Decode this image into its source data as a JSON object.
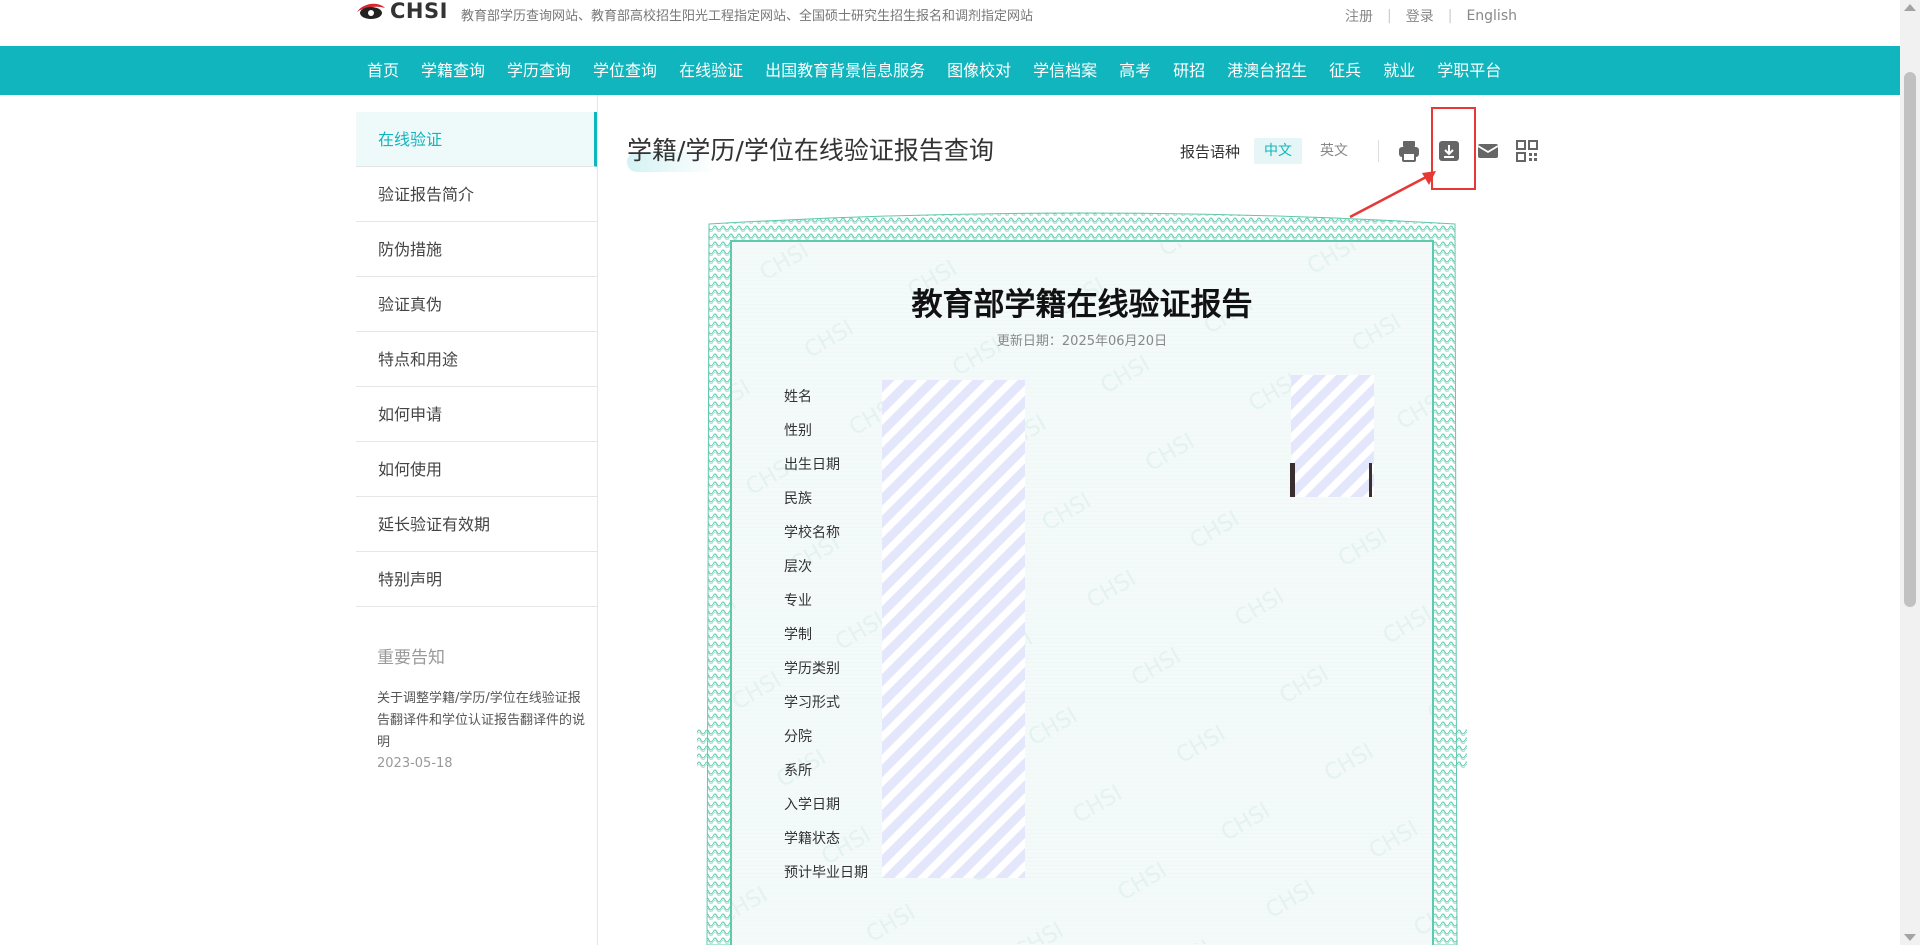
{
  "header": {
    "logo_text": "CHSI",
    "tagline": "教育部学历查询网站、教育部高校招生阳光工程指定网站、全国硕士研究生招生报名和调剂指定网站",
    "links": [
      "注册",
      "登录",
      "English"
    ]
  },
  "nav": {
    "items": [
      "首页",
      "学籍查询",
      "学历查询",
      "学位查询",
      "在线验证",
      "出国教育背景信息服务",
      "图像校对",
      "学信档案",
      "高考",
      "研招",
      "港澳台招生",
      "征兵",
      "就业",
      "学职平台"
    ]
  },
  "sidebar": {
    "items": [
      {
        "label": "在线验证",
        "active": true
      },
      {
        "label": "验证报告简介"
      },
      {
        "label": "防伪措施"
      },
      {
        "label": "验证真伪"
      },
      {
        "label": "特点和用途"
      },
      {
        "label": "如何申请"
      },
      {
        "label": "如何使用"
      },
      {
        "label": "延长验证有效期"
      },
      {
        "label": "特别声明"
      }
    ],
    "notice": {
      "title": "重要告知",
      "link": "关于调整学籍/学历/学位在线验证报告翻译件和学位认证报告翻译件的说明",
      "date": "2023-05-18"
    }
  },
  "main": {
    "title": "学籍/学历/学位在线验证报告查询",
    "language_label": "报告语种",
    "language_options": [
      "中文",
      "英文"
    ],
    "selected_language": "中文",
    "tools": [
      "print-icon",
      "download-icon",
      "email-icon",
      "qrcode-icon"
    ],
    "highlighted_tool": "download-icon"
  },
  "certificate": {
    "title": "教育部学籍在线验证报告",
    "update_date": "更新日期：2025年06月20日",
    "fields": [
      "姓名",
      "性别",
      "出生日期",
      "民族",
      "学校名称",
      "层次",
      "专业",
      "学制",
      "学历类别",
      "学习形式",
      "分院",
      "系所",
      "入学日期",
      "学籍状态",
      "预计毕业日期"
    ]
  },
  "colors": {
    "accent": "#10b5bd",
    "highlight_box": "#e53935",
    "cert_border": "#5fc9ad",
    "cert_bg": "#f3faf9"
  }
}
